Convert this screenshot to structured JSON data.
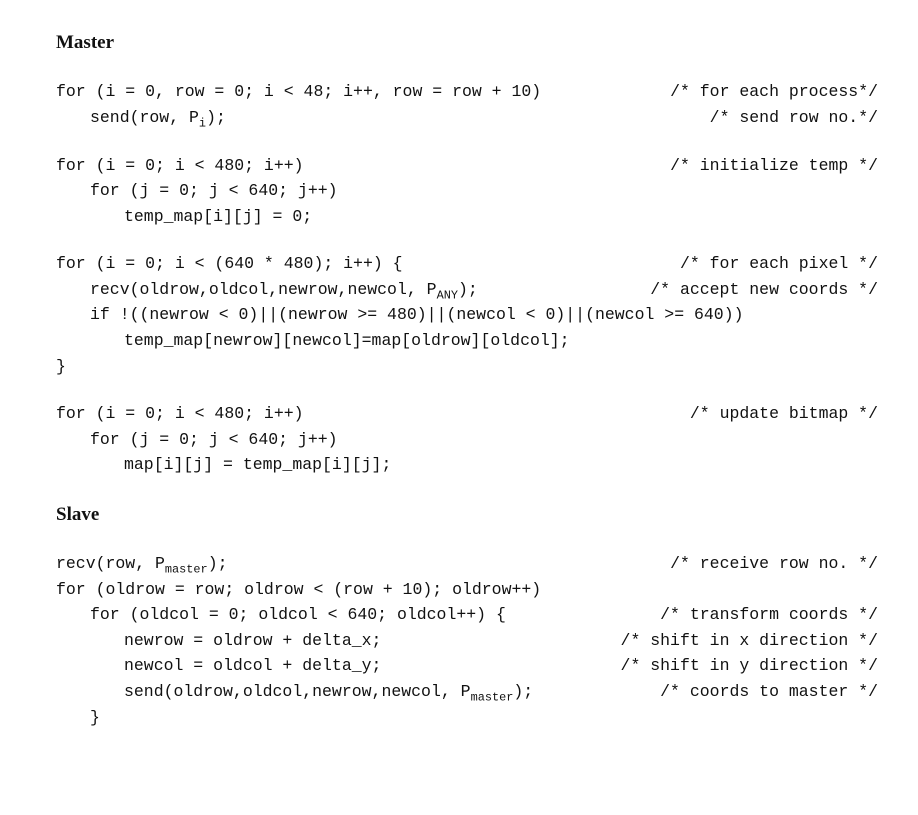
{
  "master": {
    "heading": "Master",
    "b1": {
      "l1": {
        "code": "for (i = 0, row = 0; i < 48; i++, row = row + 10)",
        "comment": "/* for each process*/"
      },
      "l2": {
        "code": "send(row, P",
        "sub": "i",
        "code2": ");",
        "comment": "/* send row no.*/"
      }
    },
    "b2": {
      "l1": {
        "code": "for (i = 0; i < 480; i++)",
        "comment": "/* initialize temp */"
      },
      "l2": {
        "code": "for (j = 0; j < 640; j++)"
      },
      "l3": {
        "code": "temp_map[i][j] = 0;"
      }
    },
    "b3": {
      "l1": {
        "code": "for (i = 0; i < (640 * 480); i++) {",
        "comment": "/* for each pixel */"
      },
      "l2": {
        "code": "recv(oldrow,oldcol,newrow,newcol, P",
        "sub": "ANY",
        "code2": ");",
        "comment": "/* accept new coords */"
      },
      "l3": {
        "code": "if !((newrow < 0)||(newrow >= 480)||(newcol < 0)||(newcol >= 640))"
      },
      "l4": {
        "code": "temp_map[newrow][newcol]=map[oldrow][oldcol];"
      },
      "l5": {
        "code": "}"
      }
    },
    "b4": {
      "l1": {
        "code": "for (i = 0; i < 480; i++)",
        "comment": "/* update bitmap */"
      },
      "l2": {
        "code": "for (j = 0; j < 640; j++)"
      },
      "l3": {
        "code": "map[i][j] = temp_map[i][j];"
      }
    }
  },
  "slave": {
    "heading": "Slave",
    "b1": {
      "l1": {
        "code": "recv(row, P",
        "sub": "master",
        "code2": ");",
        "comment": "/* receive row no. */"
      },
      "l2": {
        "code": "for (oldrow = row; oldrow < (row + 10); oldrow++)"
      },
      "l3": {
        "code": "for (oldcol = 0; oldcol < 640; oldcol++) {",
        "comment": "/* transform coords */"
      },
      "l4": {
        "code": "newrow = oldrow + delta_x;",
        "comment": "/* shift in x direction */"
      },
      "l5": {
        "code": "newcol = oldcol + delta_y;",
        "comment": "/* shift in y direction */"
      },
      "l6": {
        "code": "send(oldrow,oldcol,newrow,newcol, P",
        "sub": "master",
        "code2": ");",
        "comment": "/* coords to master */"
      },
      "l7": {
        "code": "}"
      }
    }
  }
}
